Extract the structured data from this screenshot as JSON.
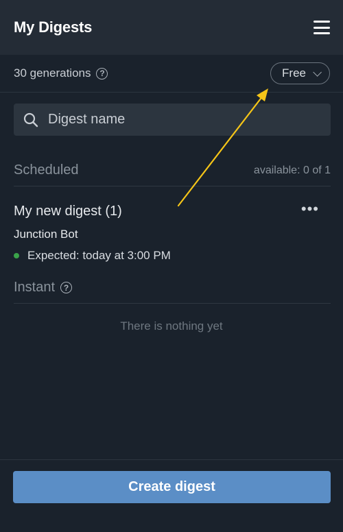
{
  "header": {
    "title": "My Digests",
    "menu_icon": "hamburger-menu-icon"
  },
  "generations": {
    "text": "30 generations",
    "help_icon": "question-circle-icon"
  },
  "plan": {
    "label": "Free",
    "icon": "chevron-down-icon"
  },
  "search": {
    "placeholder": "Digest name",
    "value": "",
    "icon": "search-icon"
  },
  "scheduled": {
    "title": "Scheduled",
    "availability": "available: 0 of 1",
    "items": [
      {
        "name": "My new digest (1)",
        "bot": "Junction Bot",
        "status": "Expected: today at 3:00 PM",
        "status_color": "#3aa34a",
        "more_icon": "more-horizontal-icon"
      }
    ]
  },
  "instant": {
    "title": "Instant",
    "help_icon": "question-circle-icon",
    "empty_text": "There is nothing yet"
  },
  "footer": {
    "create_label": "Create digest"
  },
  "annotation": {
    "arrow_color": "#f5c518"
  }
}
